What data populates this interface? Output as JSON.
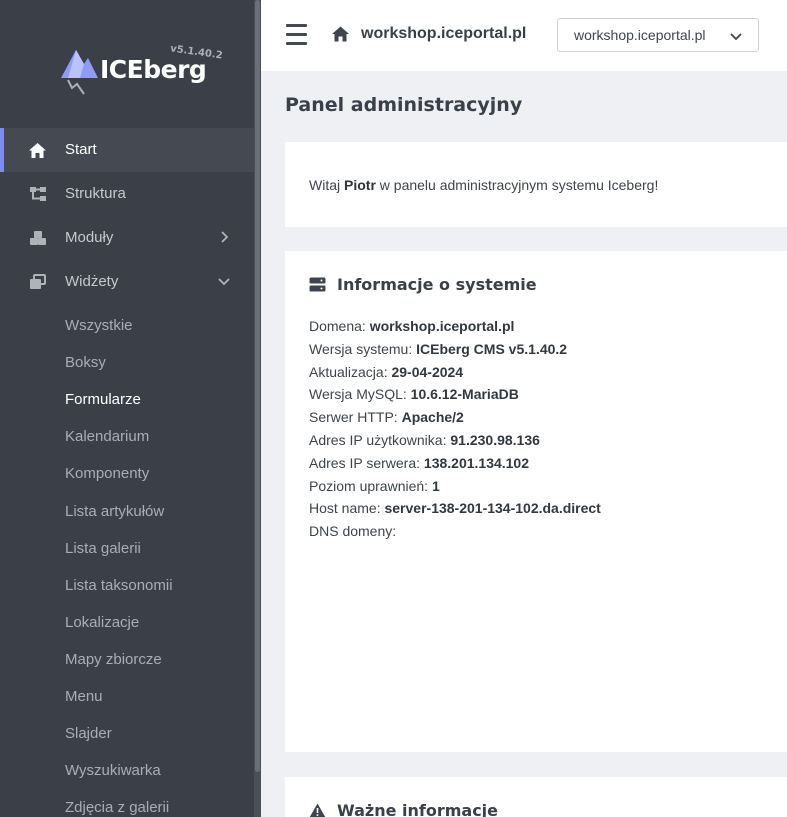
{
  "brand": {
    "name": "ICEberg",
    "version": "v5.1.40.2"
  },
  "sidebar": {
    "items": [
      {
        "label": "Start",
        "icon": "home-icon"
      },
      {
        "label": "Struktura",
        "icon": "sitemap-icon"
      },
      {
        "label": "Moduły",
        "icon": "cubes-icon"
      },
      {
        "label": "Widżety",
        "icon": "windows-icon"
      }
    ],
    "widgets_submenu": [
      "Wszystkie",
      "Boksy",
      "Formularze",
      "Kalendarium",
      "Komponenty",
      "Lista artykułów",
      "Lista galerii",
      "Lista taksonomii",
      "Lokalizacje",
      "Mapy zbiorcze",
      "Menu",
      "Slajder",
      "Wyszukiwarka",
      "Zdjęcia z galerii"
    ]
  },
  "header": {
    "site_name": "workshop.iceportal.pl",
    "site_select_value": "workshop.iceportal.pl"
  },
  "main": {
    "page_title": "Panel administracyjny",
    "welcome": {
      "prefix": "Witaj ",
      "user": "Piotr",
      "suffix": " w panelu administracyjnym systemu Iceberg!"
    },
    "system_info": {
      "title": "Informacje o systemie",
      "rows": [
        {
          "label": "Domena: ",
          "value": "workshop.iceportal.pl"
        },
        {
          "label": "Wersja systemu: ",
          "value": "ICEberg CMS v5.1.40.2"
        },
        {
          "label": "Aktualizacja: ",
          "value": "29-04-2024"
        },
        {
          "label": "Wersja MySQL: ",
          "value": "10.6.12-MariaDB"
        },
        {
          "label": "Serwer HTTP: ",
          "value": "Apache/2"
        },
        {
          "label": "Adres IP użytkownika: ",
          "value": "91.230.98.136"
        },
        {
          "label": "Adres IP serwera: ",
          "value": "138.201.134.102"
        },
        {
          "label": "Poziom uprawnień: ",
          "value": "1"
        },
        {
          "label": "Host name: ",
          "value": "server-138-201-134-102.da.direct"
        },
        {
          "label": "DNS domeny: ",
          "value": ""
        }
      ]
    },
    "important": {
      "title": "Ważne informacje"
    }
  },
  "colors": {
    "sidebar_bg": "#3b4048",
    "accent": "#7c8cf0",
    "page_bg": "#eef0f4"
  }
}
